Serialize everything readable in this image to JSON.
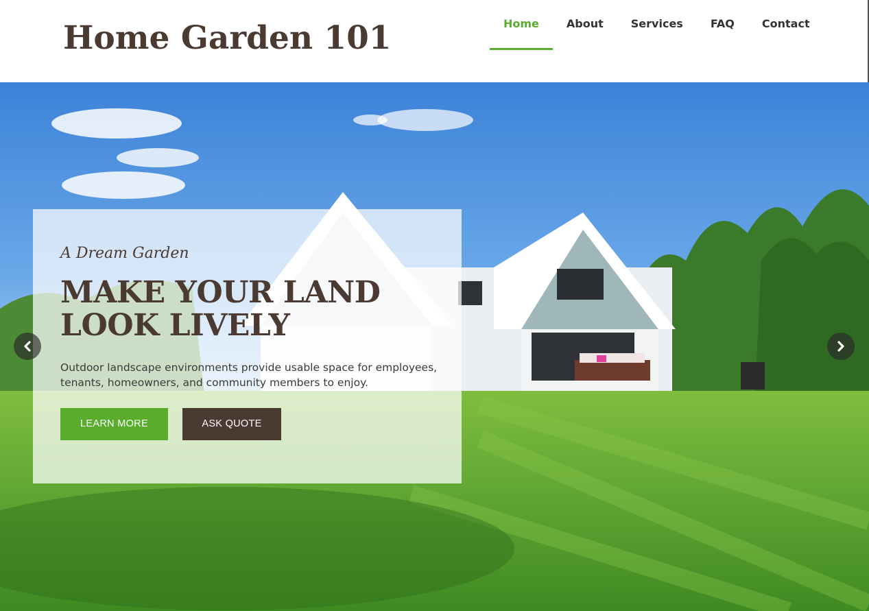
{
  "header": {
    "site_title": "Home Garden 101",
    "nav": [
      {
        "label": "Home",
        "active": true
      },
      {
        "label": "About",
        "active": false
      },
      {
        "label": "Services",
        "active": false
      },
      {
        "label": "FAQ",
        "active": false
      },
      {
        "label": "Contact",
        "active": false
      }
    ]
  },
  "hero": {
    "kicker": "A Dream Garden",
    "headline_line1": "MAKE YOUR LAND",
    "headline_line2": "LOOK LIVELY",
    "description": "Outdoor landscape environments provide usable space for employees, tenants, homeowners, and community members to enjoy.",
    "buttons": {
      "learn_more": "LEARN MORE",
      "ask_quote": "ASK QUOTE"
    },
    "controls": {
      "prev_icon": "chevron-left-icon",
      "next_icon": "chevron-right-icon"
    }
  },
  "colors": {
    "accent_green": "#5aad2c",
    "brand_brown": "#4b3a32",
    "nav_text": "#333333"
  }
}
